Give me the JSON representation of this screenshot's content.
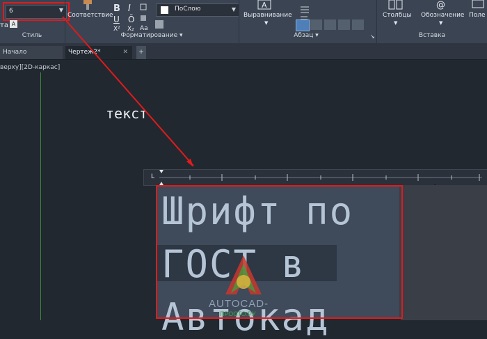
{
  "ribbon": {
    "style_panel": {
      "title": "Стиль",
      "text_height_value": "6",
      "partial_label": "та",
      "annotative_icon": "A"
    },
    "match_button_label": "Соответствие",
    "format_panel": {
      "title": "Форматирование",
      "bold": "B",
      "italic": "I",
      "underline": "U",
      "overline": "Ō",
      "superscript": "X²",
      "subscript": "X₂",
      "case": "Aa",
      "color_value": "ПоСлою"
    },
    "paragraph_panel": {
      "title": "Абзац",
      "justification_label": "Выравнивание"
    },
    "insert_panel": {
      "title": "Вставка",
      "columns_label": "Столбцы",
      "symbol_label": "Обозначение",
      "field_label": "Поле"
    }
  },
  "tabs": [
    {
      "label": "Начало"
    },
    {
      "label": "Чертеж2*"
    }
  ],
  "viewport_label": "верху][2D-каркас]",
  "canvas": {
    "small_text": "текст",
    "editor_lines": [
      "Шрифт по",
      "ГОСТ в",
      "Автокад"
    ]
  },
  "watermark": {
    "line1": "AUTOCAD-",
    "line2": "ПРОСТО.РУ"
  },
  "colors": {
    "ribbon_bg": "#3b4453",
    "canvas_bg": "#212830",
    "highlight_red": "#e01b1b",
    "editor_bg": "#3f4a5a"
  }
}
